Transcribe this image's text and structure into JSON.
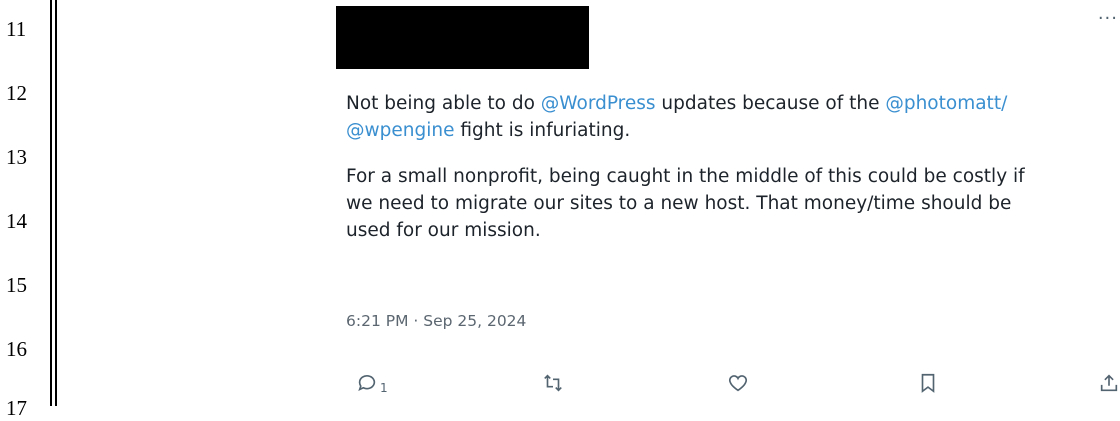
{
  "line_numbers": [
    "11",
    "12",
    "13",
    "14",
    "15",
    "16",
    "17"
  ],
  "tweet": {
    "paragraph1": [
      {
        "text": "Not being able to do ",
        "type": "text"
      },
      {
        "text": "@WordPress",
        "type": "mention"
      },
      {
        "text": " updates because of the ",
        "type": "text"
      },
      {
        "text": "@photomatt/",
        "type": "mention"
      },
      {
        "text": "@wpengine",
        "type": "mention"
      },
      {
        "text": " fight is infuriating.",
        "type": "text"
      }
    ],
    "paragraph2": "For a small nonprofit, being caught in the middle of this could be costly if we need to migrate our sites to a new host. That money/time should be used for our mission.",
    "timestamp": "6:21 PM · Sep 25, 2024",
    "more_label": "···",
    "reply_count": "1"
  },
  "icons": {
    "reply": "reply-icon",
    "retweet": "retweet-icon",
    "like": "heart-icon",
    "bookmark": "bookmark-icon",
    "share": "share-icon",
    "more": "more-icon"
  },
  "colors": {
    "mention": "#3a8fd0",
    "secondary_text": "#536471"
  }
}
